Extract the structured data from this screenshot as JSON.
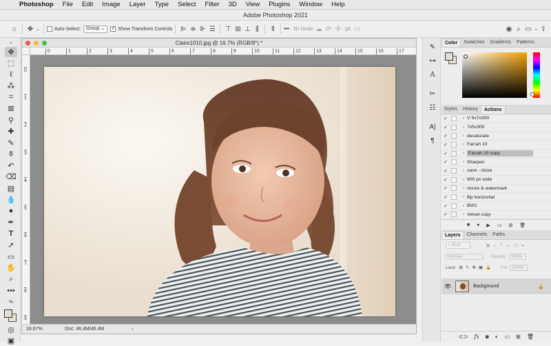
{
  "menubar": {
    "app": "Photoshop",
    "items": [
      "File",
      "Edit",
      "Image",
      "Layer",
      "Type",
      "Select",
      "Filter",
      "3D",
      "View",
      "Plugins",
      "Window",
      "Help"
    ]
  },
  "title": "Adobe Photoshop 2021",
  "options": {
    "auto_select_label": "Auto-Select:",
    "auto_select_value": "Group",
    "show_transform_label": "Show Transform Controls",
    "mode_3d_label": "3D Mode:",
    "more_label": "•••"
  },
  "document": {
    "title": "Claire1010.jpg @ 16.7% (RGB/8*) *",
    "zoom": "16.67%",
    "doc_size": "Doc: 46.4M/46.4M",
    "ruler_h": [
      "0",
      "1",
      "2",
      "3",
      "4",
      "5",
      "6",
      "7",
      "8",
      "9",
      "10",
      "11",
      "12",
      "13",
      "14",
      "15",
      "16",
      "17"
    ],
    "ruler_v": [
      "0",
      "1",
      "2",
      "3",
      "4",
      "5",
      "6",
      "7",
      "8",
      "9"
    ]
  },
  "color_panel": {
    "tabs": [
      "Color",
      "Swatches",
      "Gradients",
      "Patterns"
    ],
    "active": "Color"
  },
  "actions_panel": {
    "tabs": [
      "Styles",
      "History",
      "Actions"
    ],
    "active": "Actions",
    "items": [
      {
        "label": "V 5x7x300",
        "selected": false
      },
      {
        "label": "7x5x300",
        "selected": false
      },
      {
        "label": "desaturate",
        "selected": false
      },
      {
        "label": "Farrah 10",
        "selected": false
      },
      {
        "label": "Farrah 10 copy",
        "selected": true
      },
      {
        "label": "Sharpen",
        "selected": false
      },
      {
        "label": "save - close",
        "selected": false
      },
      {
        "label": "900 px wide",
        "selected": false
      },
      {
        "label": "resize & watermark",
        "selected": false
      },
      {
        "label": "flip horizontal",
        "selected": false
      },
      {
        "label": "BW1",
        "selected": false
      },
      {
        "label": "Velvet copy",
        "selected": false
      }
    ]
  },
  "layers_panel": {
    "tabs": [
      "Layers",
      "Channels",
      "Paths"
    ],
    "active": "Layers",
    "kind_label": "Kind",
    "blend_mode": "Normal",
    "opacity_label": "Opacity:",
    "opacity_value": "100%",
    "lock_label": "Lock:",
    "fill_label": "Fill:",
    "fill_value": "100%",
    "layers": [
      {
        "name": "Background"
      }
    ]
  },
  "colors": {
    "accent": "#c3c3c3",
    "picker_hue": "#f0a000"
  }
}
